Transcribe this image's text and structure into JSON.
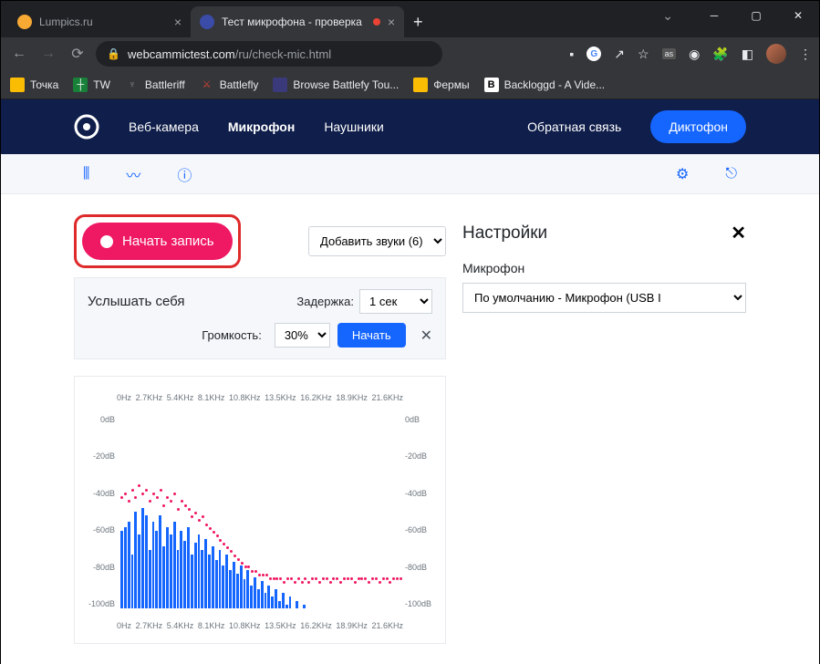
{
  "tabs": [
    {
      "title": "Lumpics.ru",
      "icon_color": "#f7a934"
    },
    {
      "title": "Тест микрофона - проверка",
      "icon_color": "#3a4ba8"
    }
  ],
  "url": {
    "domain": "webcammictest.com",
    "path": "/ru/check-mic.html"
  },
  "bookmarks": [
    {
      "label": "Точка",
      "bg": "#fbbc04",
      "fg": "#000"
    },
    {
      "label": "TW",
      "bg": "#188038",
      "fg": "#fff"
    },
    {
      "label": "Battleriff",
      "bg": "#000",
      "fg": "#888"
    },
    {
      "label": "Battlefly",
      "bg": "#000",
      "fg": "#d9432f"
    },
    {
      "label": "Browse Battlefy Tou...",
      "bg": "#3a3a7a",
      "fg": "#fff"
    },
    {
      "label": "Фермы",
      "bg": "#fbbc04",
      "fg": "#000"
    },
    {
      "label": "Backloggd - A Vide...",
      "bg": "#fff",
      "fg": "#000",
      "txt": "B"
    }
  ],
  "nav": {
    "webcam": "Веб-камера",
    "mic": "Микрофон",
    "headphones": "Наушники",
    "feedback": "Обратная связь",
    "dictaphone": "Диктофон"
  },
  "record_label": "Начать запись",
  "sounds_select": "Добавить звуки (6)",
  "hear": {
    "title": "Услышать себя",
    "delay_label": "Задержка:",
    "delay_value": "1 сек",
    "volume_label": "Громкость:",
    "volume_value": "30%",
    "start": "Начать"
  },
  "settings": {
    "title": "Настройки",
    "mic_label": "Микрофон",
    "mic_value": "По умолчанию - Микрофон (USB I"
  },
  "chart_data": {
    "type": "bar",
    "freq_labels": [
      "0Hz",
      "2.7KHz",
      "5.4KHz",
      "8.1KHz",
      "10.8KHz",
      "13.5KHz",
      "16.2KHz",
      "18.9KHz",
      "21.6KHz"
    ],
    "db_labels": [
      "0dB",
      "-20dB",
      "-40dB",
      "-60dB",
      "-80dB",
      "-100dB"
    ],
    "ylim": [
      -100,
      0
    ],
    "bars": [
      -60,
      -58,
      -55,
      -72,
      -50,
      -62,
      -48,
      -52,
      -70,
      -55,
      -60,
      -52,
      -68,
      -58,
      -62,
      -55,
      -70,
      -60,
      -65,
      -58,
      -72,
      -66,
      -62,
      -70,
      -64,
      -72,
      -68,
      -75,
      -70,
      -78,
      -72,
      -80,
      -76,
      -82,
      -78,
      -85,
      -80,
      -88,
      -84,
      -90,
      -86,
      -92,
      -88,
      -94,
      -90,
      -96,
      -92,
      -98,
      -94,
      -100,
      -96,
      -100,
      -98,
      -100,
      -100,
      -100,
      -100,
      -100,
      -100,
      -100,
      -100,
      -100,
      -100,
      -100,
      -100,
      -100,
      -100,
      -100,
      -100,
      -100,
      -100,
      -100,
      -100,
      -100,
      -100,
      -100,
      -100,
      -100,
      -100,
      -100
    ],
    "peak": [
      -42,
      -40,
      -44,
      -38,
      -42,
      -36,
      -40,
      -38,
      -44,
      -40,
      -42,
      -38,
      -46,
      -42,
      -44,
      -40,
      -48,
      -44,
      -46,
      -48,
      -52,
      -50,
      -54,
      -52,
      -56,
      -58,
      -60,
      -62,
      -64,
      -66,
      -68,
      -70,
      -72,
      -74,
      -76,
      -78,
      -78,
      -80,
      -80,
      -82,
      -82,
      -82,
      -84,
      -84,
      -84,
      -84,
      -86,
      -84,
      -84,
      -86,
      -84,
      -86,
      -84,
      -86,
      -84,
      -84,
      -86,
      -84,
      -84,
      -86,
      -84,
      -84,
      -86,
      -84,
      -84,
      -84,
      -86,
      -84,
      -84,
      -84,
      -86,
      -84,
      -84,
      -86,
      -84,
      -84,
      -86,
      -84,
      -84,
      -84
    ]
  }
}
